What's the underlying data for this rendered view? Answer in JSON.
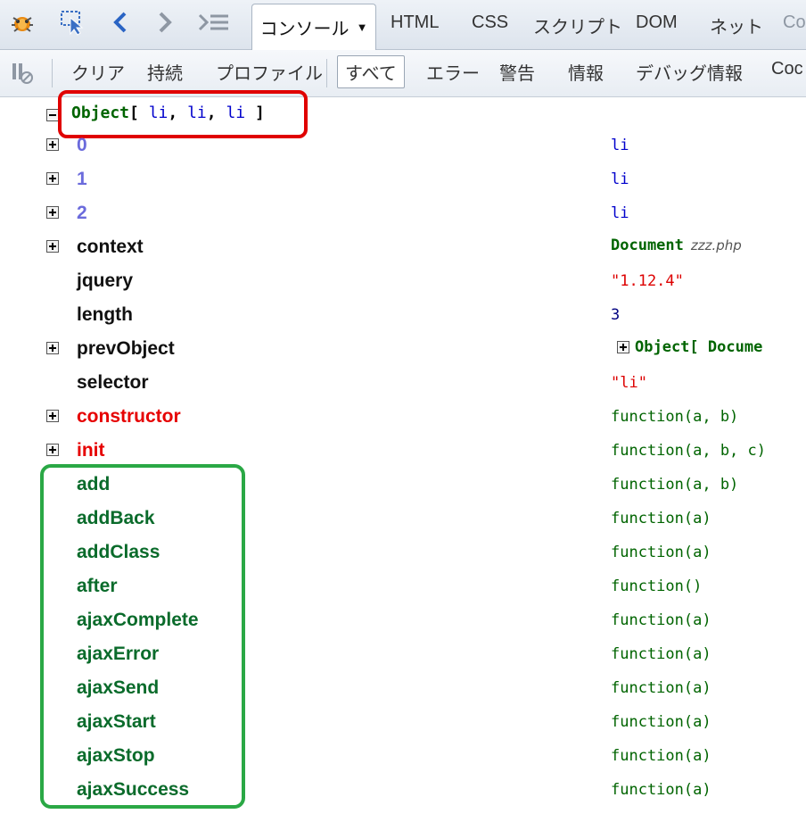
{
  "tabs": {
    "console": "コンソール",
    "html": "HTML",
    "css": "CSS",
    "script": "スクリプト",
    "dom": "DOM",
    "net": "ネット",
    "cookies_partial": "Co"
  },
  "toolbar": {
    "clear": "クリア",
    "persist": "持続",
    "profile": "プロファイル",
    "all": "すべて",
    "errors": "エラー",
    "warnings": "警告",
    "info": "情報",
    "debug_info": "デバッグ情報",
    "cookies_partial": "Coc"
  },
  "object_header": {
    "name": "Object",
    "open_bracket": "[",
    "items": [
      "li",
      "li",
      "li"
    ],
    "close_bracket": "]",
    "sep": ","
  },
  "rows": [
    {
      "key": "0",
      "value": "li"
    },
    {
      "key": "1",
      "value": "li"
    },
    {
      "key": "2",
      "value": "li"
    },
    {
      "key": "context",
      "value": "Document",
      "file": "zzz.php"
    },
    {
      "key": "jquery",
      "value": "\"1.12.4\""
    },
    {
      "key": "length",
      "value": "3"
    },
    {
      "key": "prevObject",
      "value": "Object[",
      "value2": "Docume"
    },
    {
      "key": "selector",
      "value": "\"li\""
    },
    {
      "key": "constructor",
      "value": "function(a, b)"
    },
    {
      "key": "init",
      "value": "function(a, b, c)"
    },
    {
      "key": "add",
      "value": "function(a, b)"
    },
    {
      "key": "addBack",
      "value": "function(a)"
    },
    {
      "key": "addClass",
      "value": "function(a)"
    },
    {
      "key": "after",
      "value": "function()"
    },
    {
      "key": "ajaxComplete",
      "value": "function(a)"
    },
    {
      "key": "ajaxError",
      "value": "function(a)"
    },
    {
      "key": "ajaxSend",
      "value": "function(a)"
    },
    {
      "key": "ajaxStart",
      "value": "function(a)"
    },
    {
      "key": "ajaxStop",
      "value": "function(a)"
    },
    {
      "key": "ajaxSuccess",
      "value": "function(a)"
    }
  ],
  "colors": {
    "highlight_red": "#e00000",
    "highlight_green": "#2aa845"
  }
}
